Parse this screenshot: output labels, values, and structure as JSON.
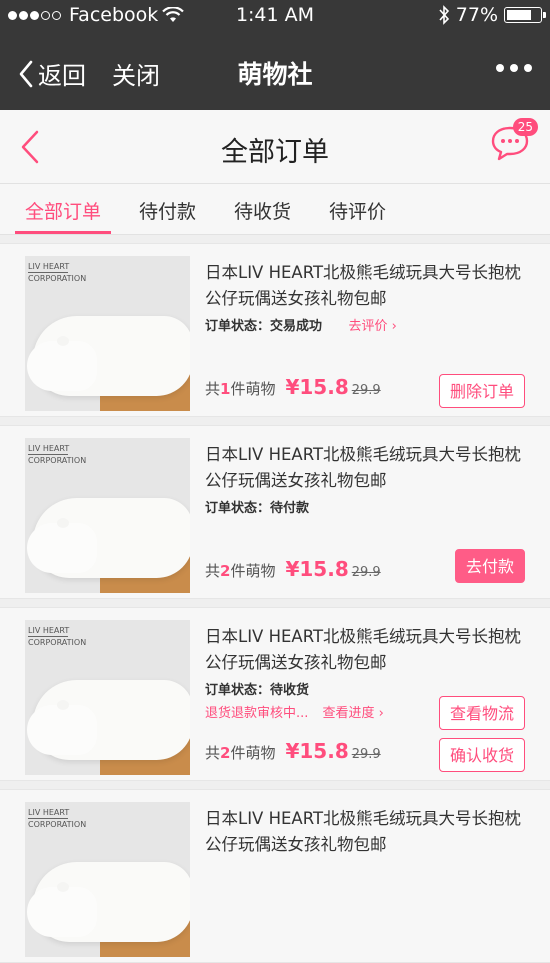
{
  "status_bar": {
    "carrier": "Facebook",
    "time": "1:41 AM",
    "battery": "77%",
    "battery_level": 0.77
  },
  "nav": {
    "back_label": "返回",
    "close_label": "关闭",
    "title": "萌物社"
  },
  "header": {
    "title": "全部订单",
    "message_count": "25"
  },
  "tabs": [
    {
      "label": "全部订单"
    },
    {
      "label": "待付款"
    },
    {
      "label": "待收货"
    },
    {
      "label": "待评价"
    }
  ],
  "product_brand": {
    "line1": "LIV HEART",
    "line2": "CORPORATION"
  },
  "orders": [
    {
      "title": "日本LIV HEART北极熊毛绒玩具大号长抱枕公仔玩偶送女孩礼物包邮",
      "status": "订单状态：交易成功",
      "status_link": "去评价 ›",
      "qty_prefix": "共",
      "qty": "1",
      "qty_suffix": "件萌物",
      "price": "¥15.8",
      "orig_price": "29.9",
      "buttons": [
        "删除订单"
      ]
    },
    {
      "title": "日本LIV HEART北极熊毛绒玩具大号长抱枕公仔玩偶送女孩礼物包邮",
      "status": "订单状态：待付款",
      "qty_prefix": "共",
      "qty": "2",
      "qty_suffix": "件萌物",
      "price": "¥15.8",
      "orig_price": "29.9",
      "buttons": [
        "去付款"
      ]
    },
    {
      "title": "日本LIV HEART北极熊毛绒玩具大号长抱枕公仔玩偶送女孩礼物包邮",
      "status": "订单状态：待收货",
      "sub_status": "退货退款审核中...",
      "sub_link": "查看进度 ›",
      "qty_prefix": "共",
      "qty": "2",
      "qty_suffix": "件萌物",
      "price": "¥15.8",
      "orig_price": "29.9",
      "buttons": [
        "查看物流",
        "确认收货"
      ]
    },
    {
      "title": "日本LIV HEART北极熊毛绒玩具大号长抱枕公仔玩偶送女孩礼物包邮"
    }
  ],
  "colors": {
    "accent": "#ff4d7d",
    "dark_bar": "#383838"
  }
}
